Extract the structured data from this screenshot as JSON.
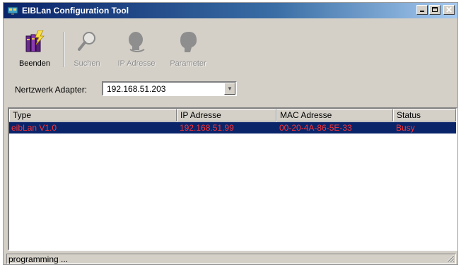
{
  "window": {
    "title": "EIBLan Configuration Tool",
    "title_buttons": {
      "minimize": "minimize-icon",
      "maximize": "maximize-icon",
      "close": "close-icon"
    }
  },
  "toolbar": {
    "beenden": {
      "label": "Beenden",
      "icon": "books-lightning-icon",
      "enabled": true
    },
    "suchen": {
      "label": "Suchen",
      "icon": "magnifier-icon",
      "enabled": false
    },
    "ip_adresse": {
      "label": "IP Adresse",
      "icon": "head-ip-icon",
      "enabled": false
    },
    "parameter": {
      "label": "Parameter",
      "icon": "head-parameter-icon",
      "enabled": false
    }
  },
  "adapter": {
    "label": "Nertzwerk Adapter:",
    "value": "192.168.51.203"
  },
  "device_list": {
    "columns": [
      "Type",
      "IP Adresse",
      "MAC Adresse",
      "Status"
    ],
    "rows": [
      {
        "type": "eibLan V1.0",
        "ip": "192.168.51.99",
        "mac": "00-20-4A-86-5E-33",
        "status": "Busy",
        "selected": true
      }
    ]
  },
  "statusbar": {
    "text": "programming ..."
  },
  "colors": {
    "titlebar": "#0a246a",
    "selection": "#0a246a",
    "row_text": "#ff3333",
    "face": "#d4d0c8"
  }
}
